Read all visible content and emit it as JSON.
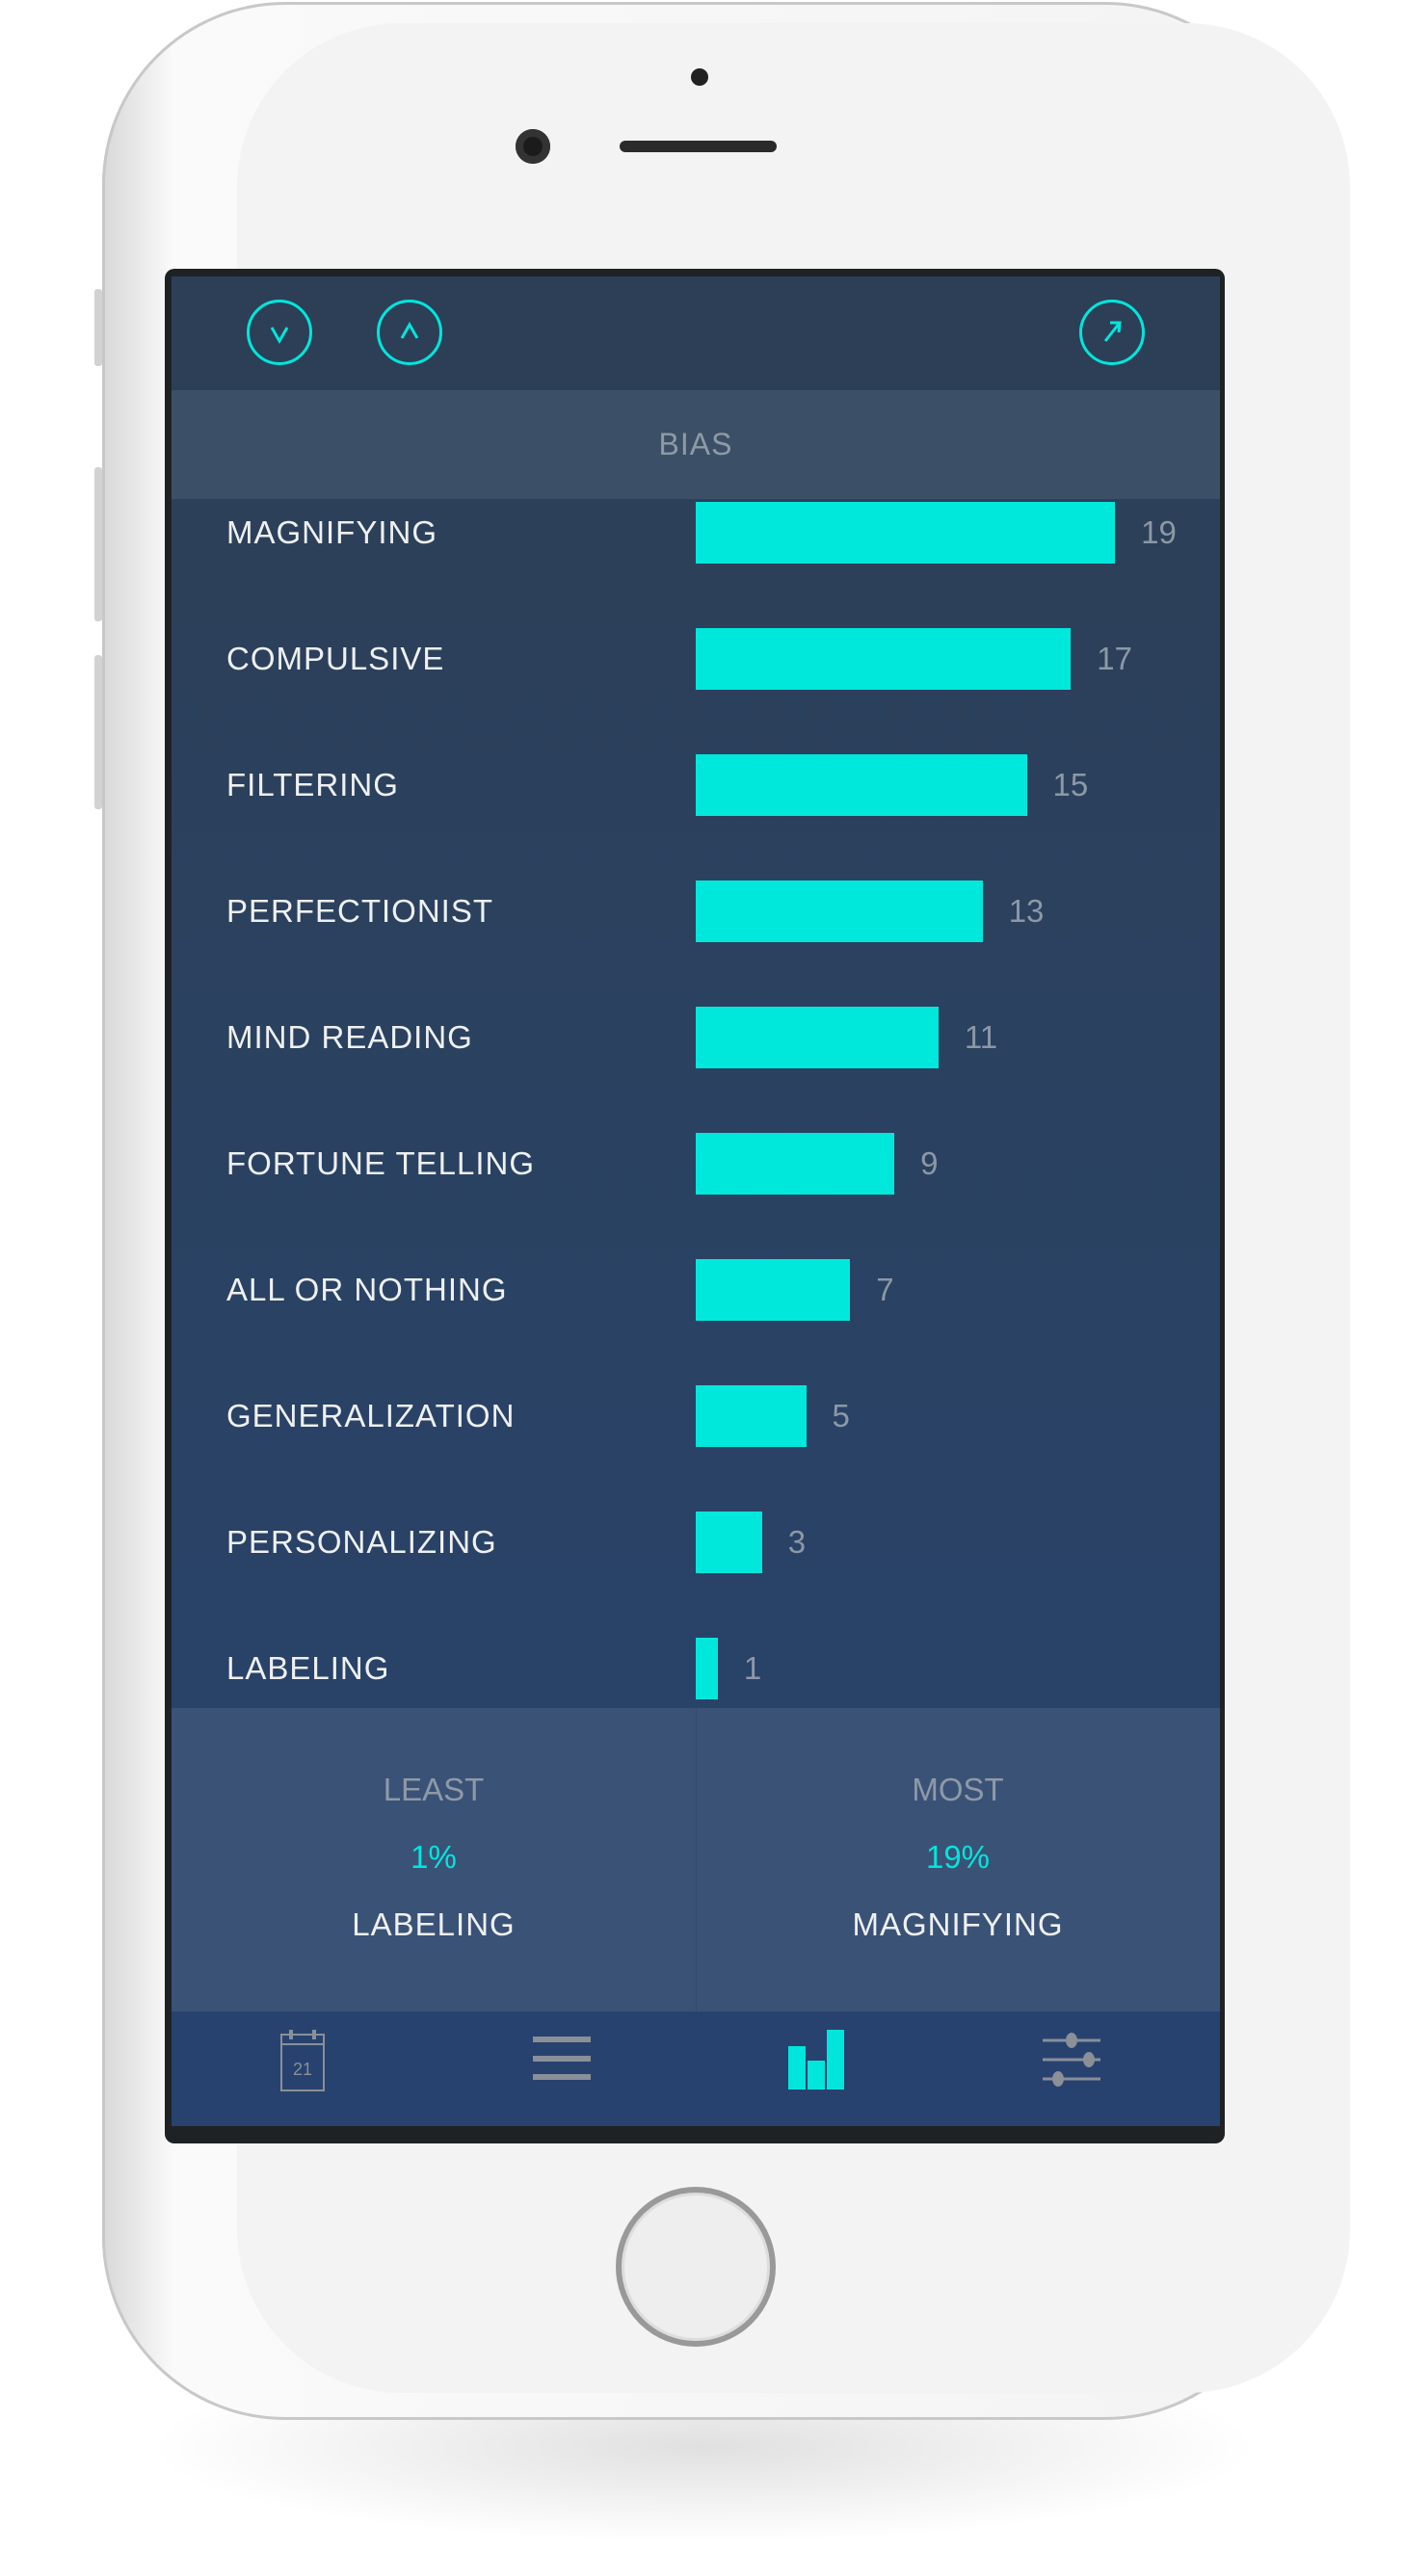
{
  "header": {
    "icons": [
      "chevron-down-circle-icon",
      "chevron-up-circle-icon",
      "share-arrow-circle-icon"
    ]
  },
  "section_title": "BIAS",
  "chart_data": {
    "type": "bar",
    "orientation": "horizontal",
    "categories": [
      "MAGNIFYING",
      "COMPULSIVE",
      "FILTERING",
      "PERFECTIONIST",
      "MIND READING",
      "FORTUNE TELLING",
      "ALL OR NOTHING",
      "GENERALIZATION",
      "PERSONALIZING",
      "LABELING"
    ],
    "values": [
      19,
      17,
      15,
      13,
      11,
      9,
      7,
      5,
      3,
      1
    ],
    "value_labels": [
      "19",
      "17",
      "15",
      "13",
      "11",
      "9",
      "7",
      "5",
      "3",
      "1"
    ],
    "bar_color": "#00e8dc"
  },
  "stats": {
    "least": {
      "title": "LEAST",
      "percent": "1%",
      "name": "LABELING"
    },
    "most": {
      "title": "MOST",
      "percent": "19%",
      "name": "MAGNIFYING"
    }
  },
  "tabbar": {
    "calendar_day": "21",
    "items": [
      "calendar-icon",
      "list-icon",
      "chart-icon",
      "settings-sliders-icon"
    ],
    "active": "chart-icon"
  },
  "colors": {
    "accent": "#00e6dc",
    "background": "#2b4260"
  }
}
